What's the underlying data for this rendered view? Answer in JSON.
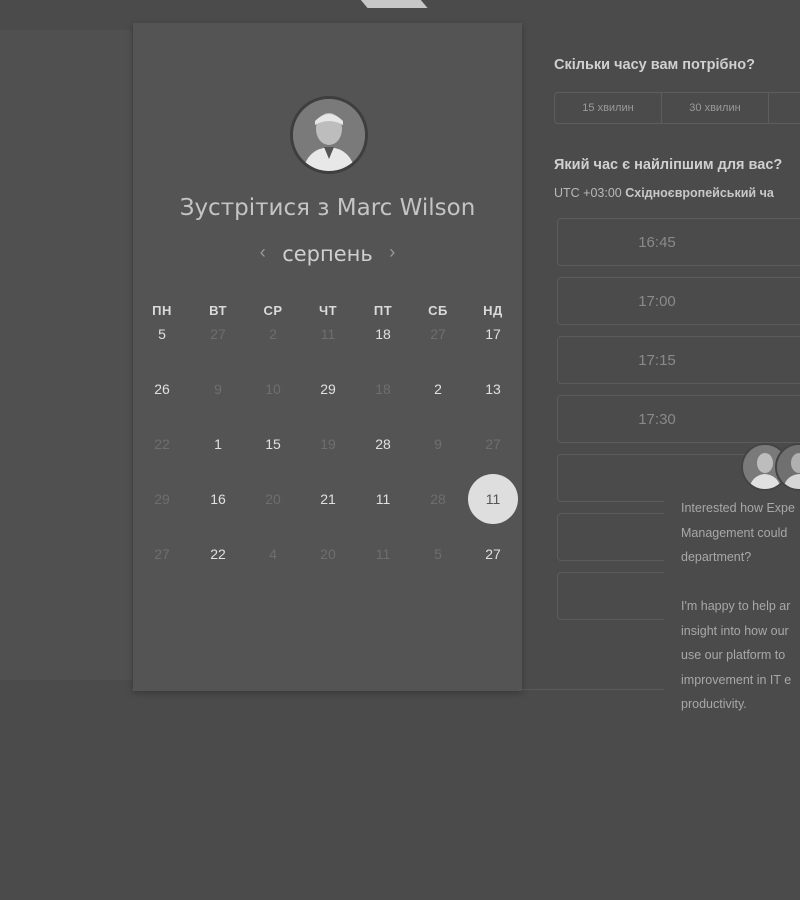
{
  "calendar": {
    "title": "Зустрітися з Marc Wilson",
    "month": "серпень",
    "prev_icon": "chevron-left-icon",
    "next_icon": "chevron-right-icon",
    "weekdays": [
      "ПН",
      "ВТ",
      "СР",
      "ЧТ",
      "ПТ",
      "СБ",
      "НД"
    ],
    "weeks": [
      [
        "5",
        "27",
        "2",
        "11",
        "18",
        "27",
        "17"
      ],
      [
        "26",
        "9",
        "10",
        "29",
        "18",
        "2",
        "13"
      ],
      [
        "22",
        "1",
        "15",
        "19",
        "28",
        "9",
        "27"
      ],
      [
        "29",
        "16",
        "20",
        "21",
        "11",
        "28",
        "11"
      ],
      [
        "27",
        "22",
        "4",
        "20",
        "11",
        "5",
        "27"
      ]
    ],
    "selected_day": "11"
  },
  "booking": {
    "duration_question": "Скільки часу вам потрібно?",
    "durations": [
      "15 хвилин",
      "30 хвилин"
    ],
    "time_question": "Який час є найліпшим для вас?",
    "timezone_offset": "UTC +03:00",
    "timezone_name": "Східноєвропейський ча",
    "slots": [
      "16:45",
      "17:00",
      "17:15",
      "17:30",
      "",
      "",
      ""
    ]
  },
  "chat": {
    "message": "Interested how Expe\nManagement could\ndepartment?\n\nI'm happy to help ar\ninsight into how our\nuse our platform to\nimprovement in IT e\nproductivity."
  }
}
